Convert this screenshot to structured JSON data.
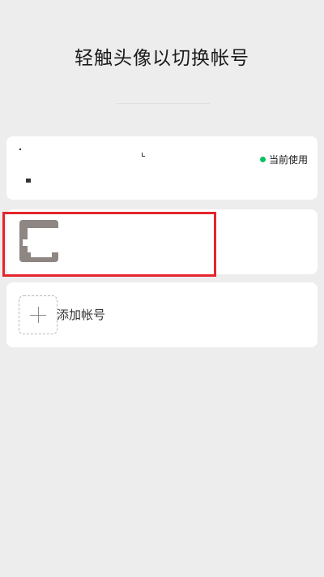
{
  "header": {
    "title": "轻触头像以切换帐号"
  },
  "accounts": {
    "current": {
      "status_label": "当前使用",
      "status_color": "#07c160"
    },
    "add": {
      "label": "添加帐号",
      "icon": "plus-icon"
    }
  },
  "colors": {
    "background": "#ededed",
    "card": "#ffffff",
    "highlight": "#e6242c",
    "accent_green": "#07c160"
  }
}
